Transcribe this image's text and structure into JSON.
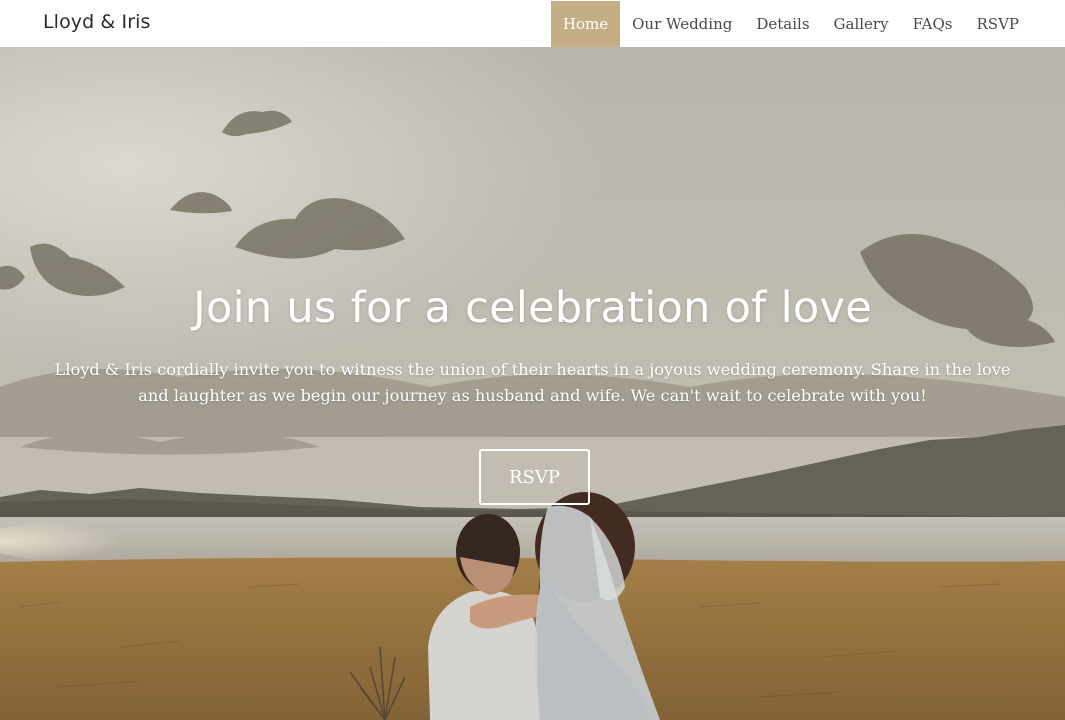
{
  "navbar": {
    "brand": "Lloyd & Iris",
    "links": [
      {
        "label": "Home",
        "active": true
      },
      {
        "label": "Our Wedding",
        "active": false
      },
      {
        "label": "Details",
        "active": false
      },
      {
        "label": "Gallery",
        "active": false
      },
      {
        "label": "FAQs",
        "active": false
      },
      {
        "label": "RSVP",
        "active": false
      }
    ],
    "active_color": "#c5ae86"
  },
  "hero": {
    "title": "Join us for a celebration of love",
    "text": "Lloyd & Iris cordially invite you to witness the union of their hearts in a joyous wedding ceremony. Share in the love and laughter as we begin our journey as husband and wife. We can't wait to celebrate with you!",
    "button_label": "RSVP",
    "background_image": "couple embracing in a golden field by a lake under a cloudy sky"
  }
}
